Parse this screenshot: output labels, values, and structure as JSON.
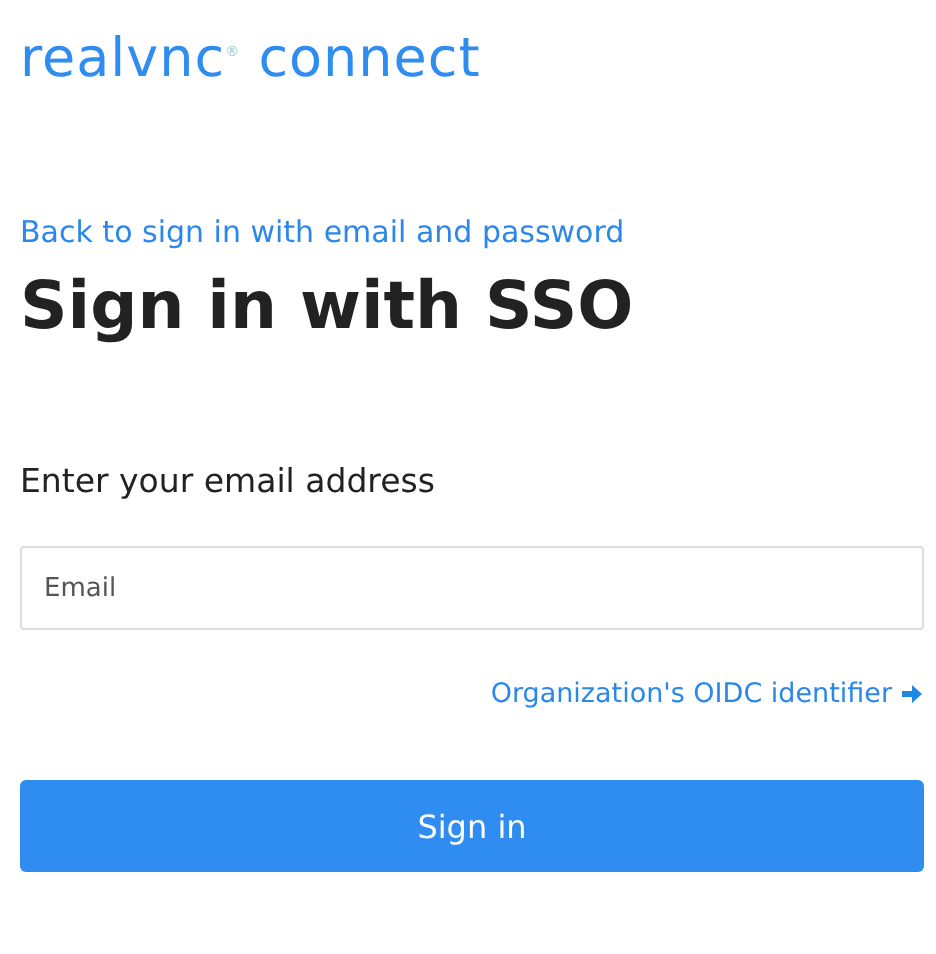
{
  "logo": {
    "text": "realvnc$^{®}$ connect"
  },
  "back_link": "Back to sign in with email and password",
  "heading": "Sign in with SSO",
  "email_label": "Enter your email address",
  "email_field": {
    "placeholder": "Email"
  },
  "oidc_link": "Organization's OIDC identifier",
  "sign_in_button": "Sign in"
}
